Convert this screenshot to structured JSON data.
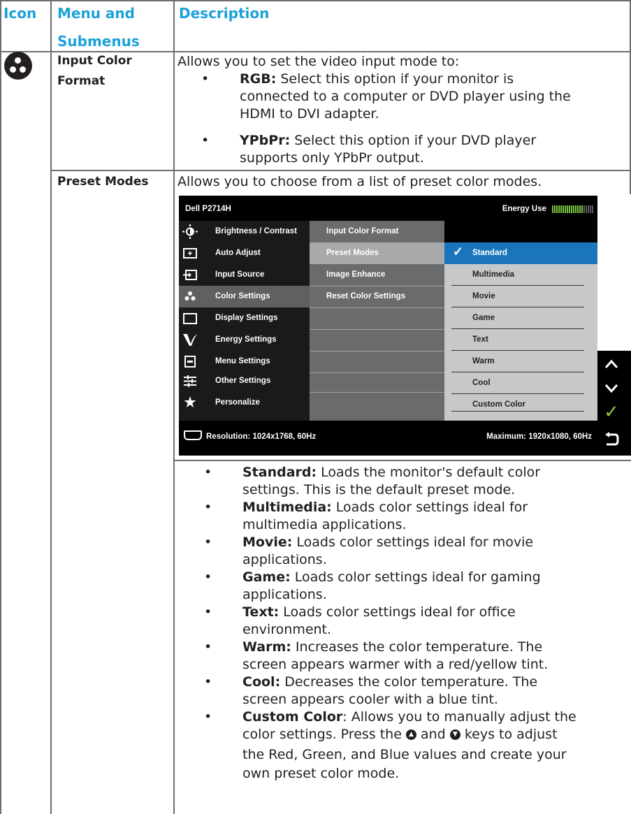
{
  "table": {
    "header": {
      "icon": "Icon",
      "menu_line1": "Menu and",
      "menu_line2": "Submenus",
      "description": "Description"
    },
    "rows": [
      {
        "icon": "color-settings-icon",
        "menu_line1": "Input Color",
        "menu_line2": "Format",
        "intro": "Allows you to set the video input mode to:",
        "bullets": [
          {
            "term": "RGB:",
            "line1": " Select this option if your monitor is",
            "line2": "connected to a computer or DVD player using the",
            "line3": "HDMI to DVI adapter."
          },
          {
            "term": "YPbPr:",
            "line1": " Select this option if your DVD player",
            "line2": "supports only YPbPr output."
          }
        ]
      },
      {
        "menu_line1": "Preset Modes",
        "intro": "Allows you to choose from a list of preset color modes.",
        "bullets": [
          {
            "term": "Standard:",
            "line1": " Loads the monitor's default color",
            "line2": "settings. This is the default preset mode."
          },
          {
            "term": "Multimedia:",
            "line1": " Loads color settings ideal for",
            "line2": "multimedia applications."
          },
          {
            "term": "Movie:",
            "line1": " Loads color settings ideal for movie",
            "line2": "applications."
          },
          {
            "term": "Game:",
            "line1": " Loads color settings ideal for gaming",
            "line2": "applications."
          },
          {
            "term": "Text:",
            "line1": " Loads color settings ideal for office",
            "line2": "environment."
          },
          {
            "term": "Warm:",
            "line1": " Increases the color temperature. The",
            "line2": "screen appears warmer with a red/yellow tint."
          },
          {
            "term": "Cool:",
            "line1": " Decreases the color temperature. The",
            "line2": "screen appears cooler with a blue tint."
          },
          {
            "term": "Custom Color",
            "line1": ": Allows you to manually adjust the",
            "line2a": "color settings. Press the",
            "line2b": "and",
            "line2c": "keys to adjust",
            "line3": "the Red, Green, and Blue values and create your",
            "line4": "own preset color mode."
          }
        ]
      }
    ]
  },
  "osd": {
    "title": "Dell P2714H",
    "energy_label": "Energy Use",
    "energy_level": 0.75,
    "menu": [
      {
        "label": "Brightness / Contrast",
        "icon": "brightness-icon"
      },
      {
        "label": "Auto Adjust",
        "icon": "auto-adjust-icon"
      },
      {
        "label": "Input Source",
        "icon": "input-source-icon"
      },
      {
        "label": "Color Settings",
        "icon": "color-settings-icon"
      },
      {
        "label": "Display Settings",
        "icon": "display-settings-icon"
      },
      {
        "label": "Energy Settings",
        "icon": "energy-settings-icon"
      },
      {
        "label": "Menu Settings",
        "icon": "menu-settings-icon"
      },
      {
        "label": "Other Settings",
        "icon": "other-settings-icon"
      },
      {
        "label": "Personalize",
        "icon": "star-icon"
      }
    ],
    "submenu": [
      "Input Color Format",
      "Preset Modes",
      "Image Enhance",
      "Reset Color Settings"
    ],
    "options": [
      "Standard",
      "Multimedia",
      "Movie",
      "Game",
      "Text",
      "Warm",
      "Cool",
      "Custom Color"
    ],
    "resolution": "Resolution: 1024x1768, 60Hz",
    "maximum": "Maximum: 1920x1080, 60Hz",
    "nav_buttons": [
      "up-arrow-icon",
      "down-arrow-icon",
      "check-icon",
      "back-icon"
    ],
    "colors": {
      "accent": "#1ba1d8",
      "selected_option": "#1b75bb",
      "check_green": "#8dc63f"
    }
  }
}
